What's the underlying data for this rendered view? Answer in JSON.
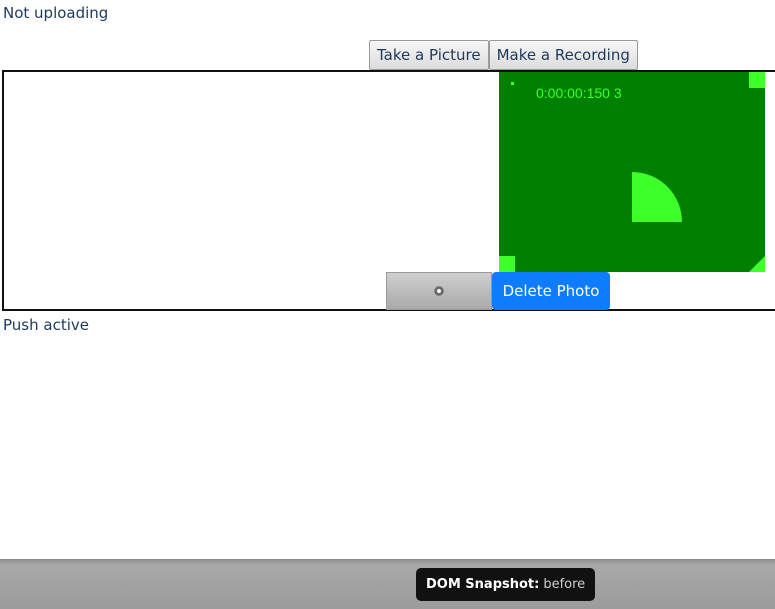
{
  "status": {
    "upload": "Not uploading",
    "push": "Push active"
  },
  "toolbar": {
    "take_picture": "Take a Picture",
    "make_recording": "Make a Recording"
  },
  "video": {
    "timecode": "0:00:00:150 3",
    "background_color": "#008000",
    "accent_color": "#3dff2a"
  },
  "preview": {
    "delete_label": "Delete Photo",
    "delete_color": "#0d7cff"
  },
  "footer": {
    "snapshot_label": "DOM Snapshot:",
    "snapshot_state": "before"
  }
}
